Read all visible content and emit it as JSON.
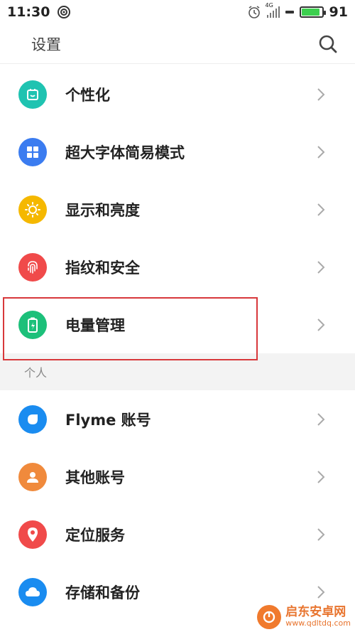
{
  "status_bar": {
    "time": "11:30",
    "network": "4G",
    "battery_level": "91"
  },
  "header": {
    "title": "设置"
  },
  "items_top": [
    {
      "label": "个性化",
      "icon": "personalize-icon",
      "color": "#1fc3b1"
    },
    {
      "label": "超大字体简易模式",
      "icon": "grid-icon",
      "color": "#3b7cf0"
    },
    {
      "label": "显示和亮度",
      "icon": "sun-icon",
      "color": "#f5b800"
    },
    {
      "label": "指纹和安全",
      "icon": "fingerprint-icon",
      "color": "#f04a4a"
    },
    {
      "label": "电量管理",
      "icon": "battery-icon",
      "color": "#1cc07a"
    }
  ],
  "section": {
    "label": "个人"
  },
  "items_personal": [
    {
      "label": "Flyme 账号",
      "icon": "flyme-icon",
      "color": "#1a8cf0"
    },
    {
      "label": "其他账号",
      "icon": "person-icon",
      "color": "#f08a3c"
    },
    {
      "label": "定位服务",
      "icon": "location-icon",
      "color": "#f04a4a"
    },
    {
      "label": "存储和备份",
      "icon": "cloud-icon",
      "color": "#1a8cf0"
    }
  ],
  "watermark": {
    "title": "启东安卓网",
    "url": "www.qdltdq.com"
  }
}
